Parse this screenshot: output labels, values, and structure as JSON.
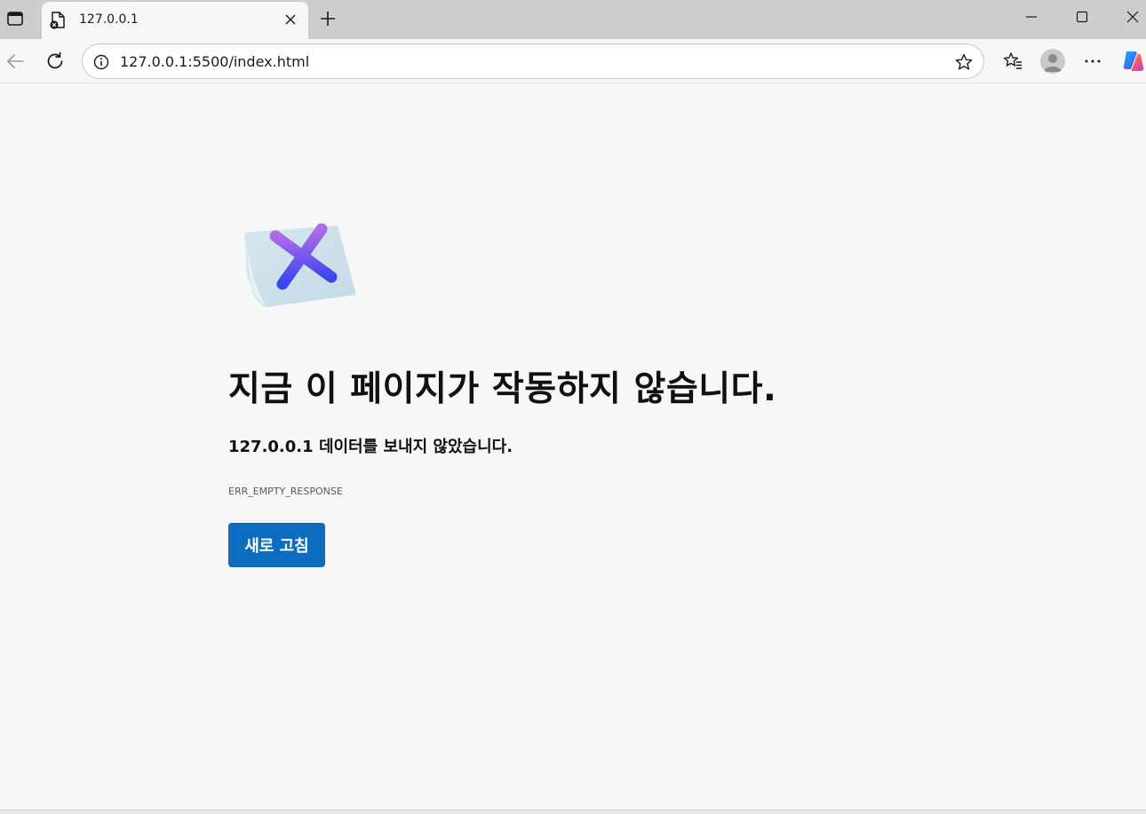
{
  "browser": {
    "tab": {
      "title": "127.0.0.1",
      "favicon": "error-page-icon",
      "close_icon": "close-icon"
    },
    "new_tab_icon": "plus-icon",
    "window_controls": [
      "minimize-icon",
      "maximize-icon",
      "close-icon"
    ],
    "address_bar": {
      "url": "127.0.0.1:5500/index.html",
      "info_icon": "info-icon",
      "favorite_icon": "star-icon"
    },
    "toolbar_icons": [
      "back-icon",
      "refresh-icon",
      "favorites-icon",
      "profile-avatar",
      "more-icon",
      "copilot-icon"
    ]
  },
  "error_page": {
    "heading": "지금 이 페이지가 작동하지 않습니다.",
    "host": "127.0.0.1",
    "message": " 데이터를 보내지 않았습니다.",
    "error_code": "ERR_EMPTY_RESPONSE",
    "reload_label": "새로 고침",
    "illustration": "error-x-document"
  },
  "colors": {
    "accent": "#0b6cc0",
    "page_background": "#f7f7f7",
    "tabstrip": "#cdcdcd"
  }
}
